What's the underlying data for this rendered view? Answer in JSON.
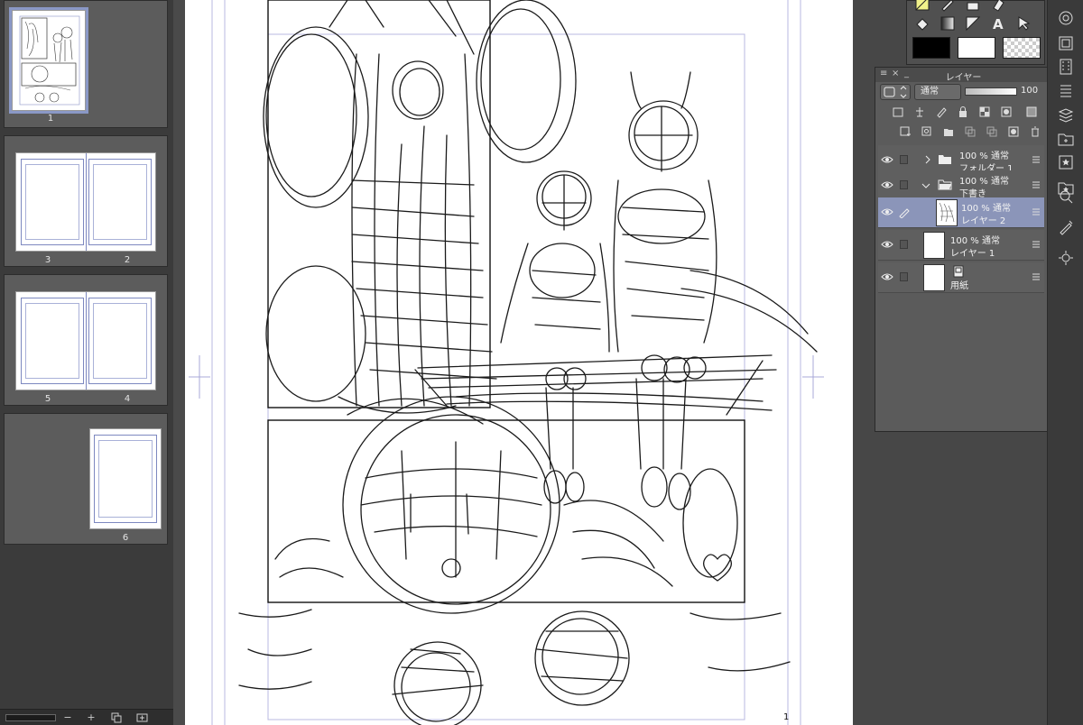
{
  "page_navigator": {
    "pages": [
      {
        "labels": [
          "1"
        ],
        "selected": true
      },
      {
        "labels": [
          "3",
          "2"
        ],
        "selected": false
      },
      {
        "labels": [
          "5",
          "4"
        ],
        "selected": false
      },
      {
        "labels": [
          "6"
        ],
        "selected": false
      }
    ],
    "zoom_out_label": "−",
    "zoom_in_label": "+"
  },
  "canvas": {
    "page_number": "1"
  },
  "layer_panel": {
    "title": "レイヤー",
    "close_label": "×",
    "minimize_label": "_",
    "grip_label": "≡",
    "blend_mode": "通常",
    "opacity": "100",
    "layers": [
      {
        "opacity_mode": "100 % 通常",
        "name": "フォルダー 1",
        "type": "folder",
        "expanded": false,
        "selected": false
      },
      {
        "opacity_mode": "100 % 通常",
        "name": "下書き",
        "type": "folder",
        "expanded": true,
        "selected": false
      },
      {
        "opacity_mode": "100 % 通常",
        "name": "レイヤー 2",
        "type": "raster",
        "selected": true
      },
      {
        "opacity_mode": "100 % 通常",
        "name": "レイヤー 1",
        "type": "raster",
        "selected": false
      },
      {
        "opacity_mode": "",
        "name": "用紙",
        "type": "paper",
        "selected": false
      }
    ]
  },
  "colors": {
    "main_color": "#000000",
    "sub_color": "#ffffff",
    "selection_highlight": "#8b95b9",
    "panel_bg": "#5b5b5b"
  }
}
